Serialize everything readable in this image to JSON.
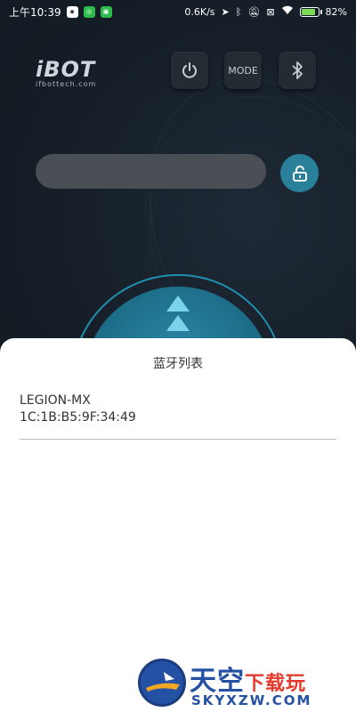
{
  "status_bar": {
    "time": "上午10:39",
    "speed": "0.6K/s",
    "battery": "82%",
    "battery_level": 0.82
  },
  "header": {
    "logo_main": "iBOT",
    "logo_sub": "ifbottech.com",
    "mode_label": "MODE"
  },
  "sheet": {
    "title": "蓝牙列表",
    "devices": [
      {
        "name": "LEGION-MX",
        "mac": "1C:1B:B5:9F:34:49"
      }
    ]
  },
  "watermark": {
    "main": "天空",
    "accent": "下载玩",
    "url": "SKYXZW.COM"
  },
  "colors": {
    "accent": "#2a7f9b",
    "background": "#141c25",
    "sheet": "#ffffff"
  }
}
